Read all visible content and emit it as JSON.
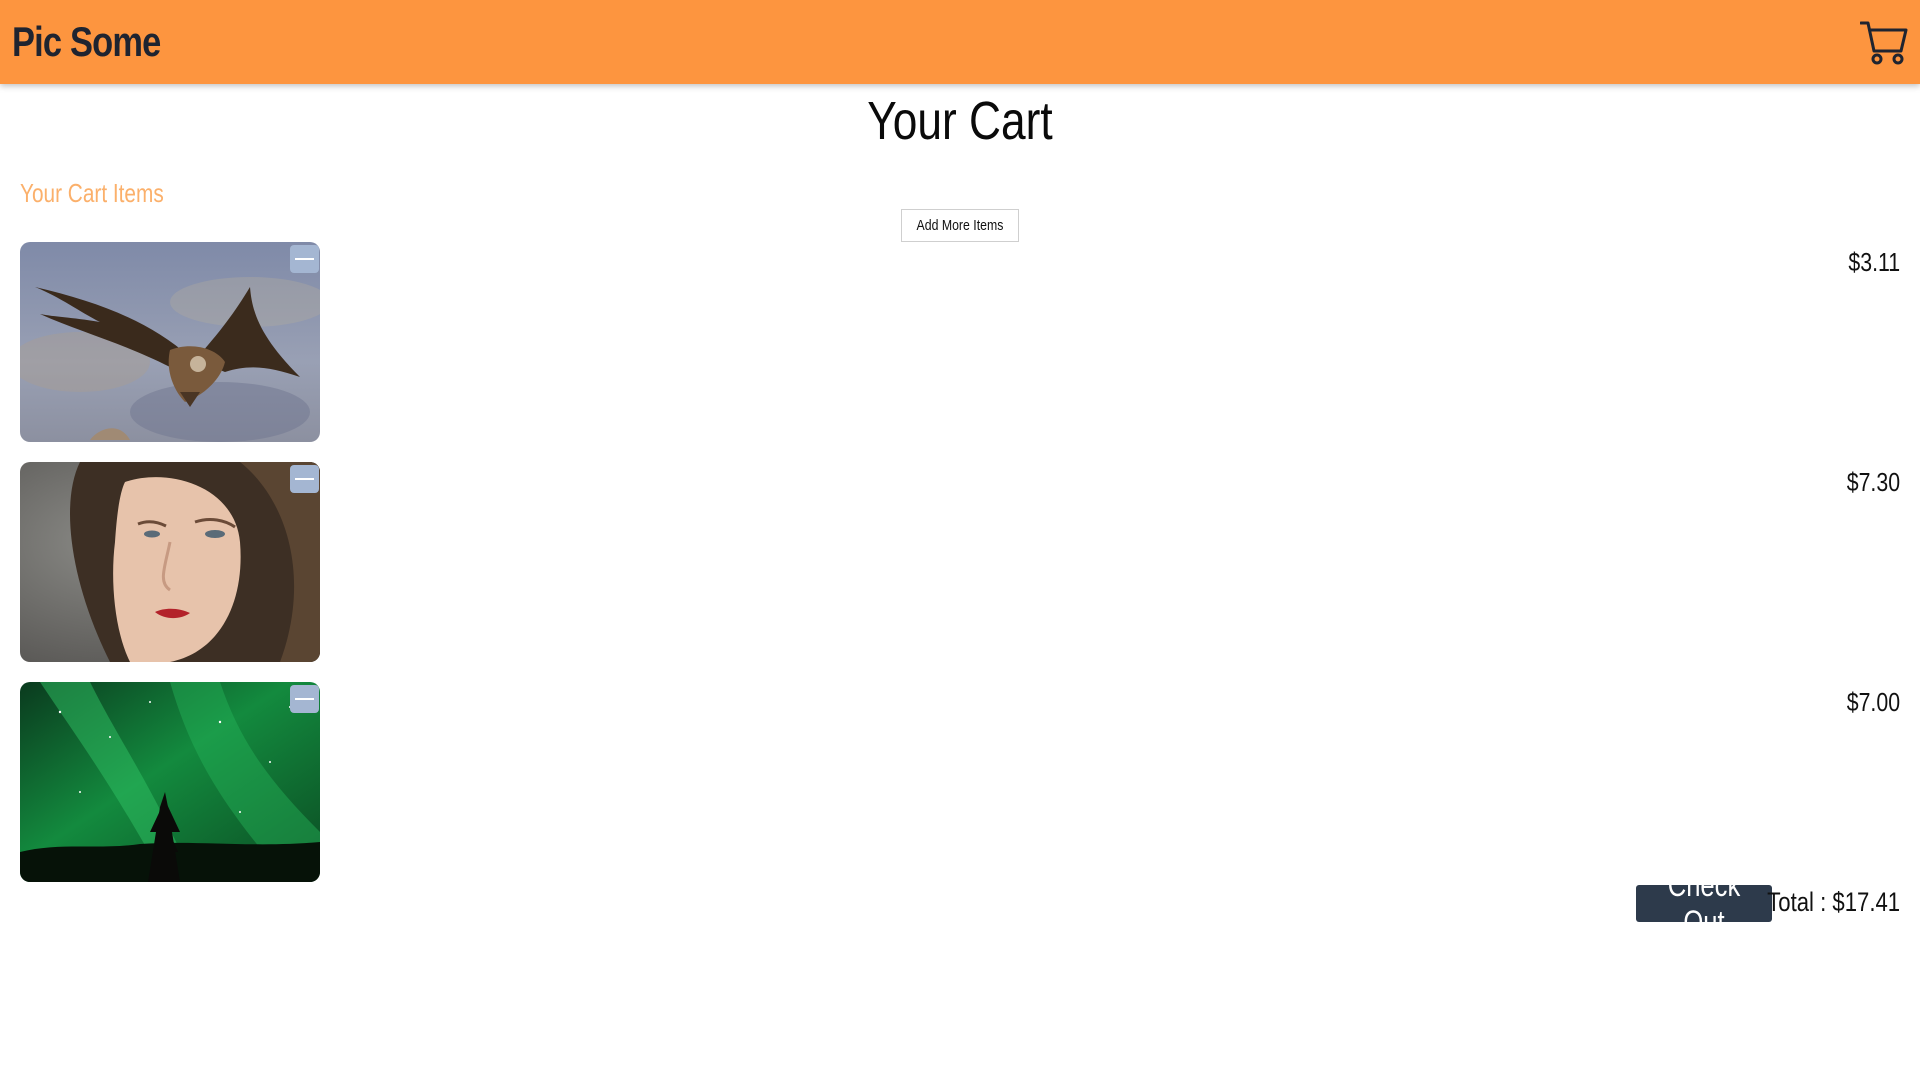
{
  "header": {
    "brand": "Pic Some",
    "cart_icon": "cart-icon",
    "bar_color": "#fd953f"
  },
  "page_title": "Your Cart",
  "section_label": "Your Cart Items",
  "add_more_label": "Add More Items",
  "items": [
    {
      "image": "vulture-in-flight",
      "price": "$3.11",
      "remove_icon": "minus-icon"
    },
    {
      "image": "woman-portrait",
      "price": "$7.30",
      "remove_icon": "minus-icon"
    },
    {
      "image": "aurora-night-sky",
      "price": "$7.00",
      "remove_icon": "minus-icon"
    }
  ],
  "checkout_label": "Check Out",
  "total_text": "Total : $17.41",
  "colors": {
    "accent": "#fd953f",
    "section_label": "#fbb06b",
    "checkout_bg": "#2d3a4b",
    "remove_btn": "#a4b6d2"
  }
}
